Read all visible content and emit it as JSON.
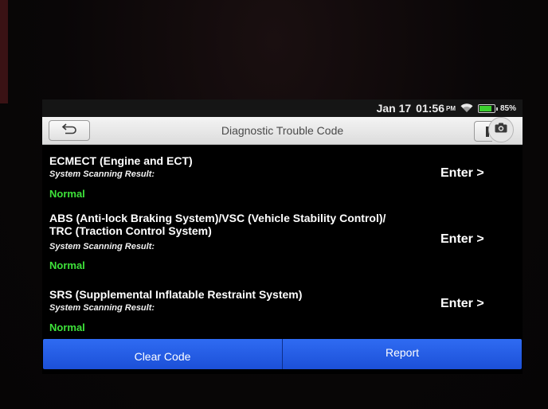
{
  "status": {
    "date": "Jan 17",
    "time": "01:56",
    "ampm": "PM",
    "battery_percent": "85%",
    "battery_level": 0.85,
    "wifi_icon": "wifi-icon",
    "battery_color": "#3ccf2f"
  },
  "header": {
    "title": "Diagnostic Trouble Code",
    "back_icon": "back-arrow-icon",
    "camera_icon": "camera-icon"
  },
  "systems": [
    {
      "name_lines": [
        "ECMECT (Engine and ECT)"
      ],
      "scan_label": "System Scanning Result:",
      "result": "Normal",
      "enter_label": "Enter >"
    },
    {
      "name_lines": [
        "ABS (Anti-lock Braking System)/VSC (Vehicle Stability Control)/",
        "TRC (Traction Control System)"
      ],
      "scan_label": "System Scanning Result:",
      "result": "Normal",
      "enter_label": "Enter >"
    },
    {
      "name_lines": [
        "SRS (Supplemental Inflatable Restraint System)"
      ],
      "scan_label": "System Scanning Result:",
      "result": "Normal",
      "enter_label": "Enter >"
    }
  ],
  "footer": {
    "clear_code_label": "Clear Code",
    "report_label": "Report"
  },
  "colors": {
    "accent_blue": "#2f6bf2",
    "normal_green": "#3ee23a"
  }
}
